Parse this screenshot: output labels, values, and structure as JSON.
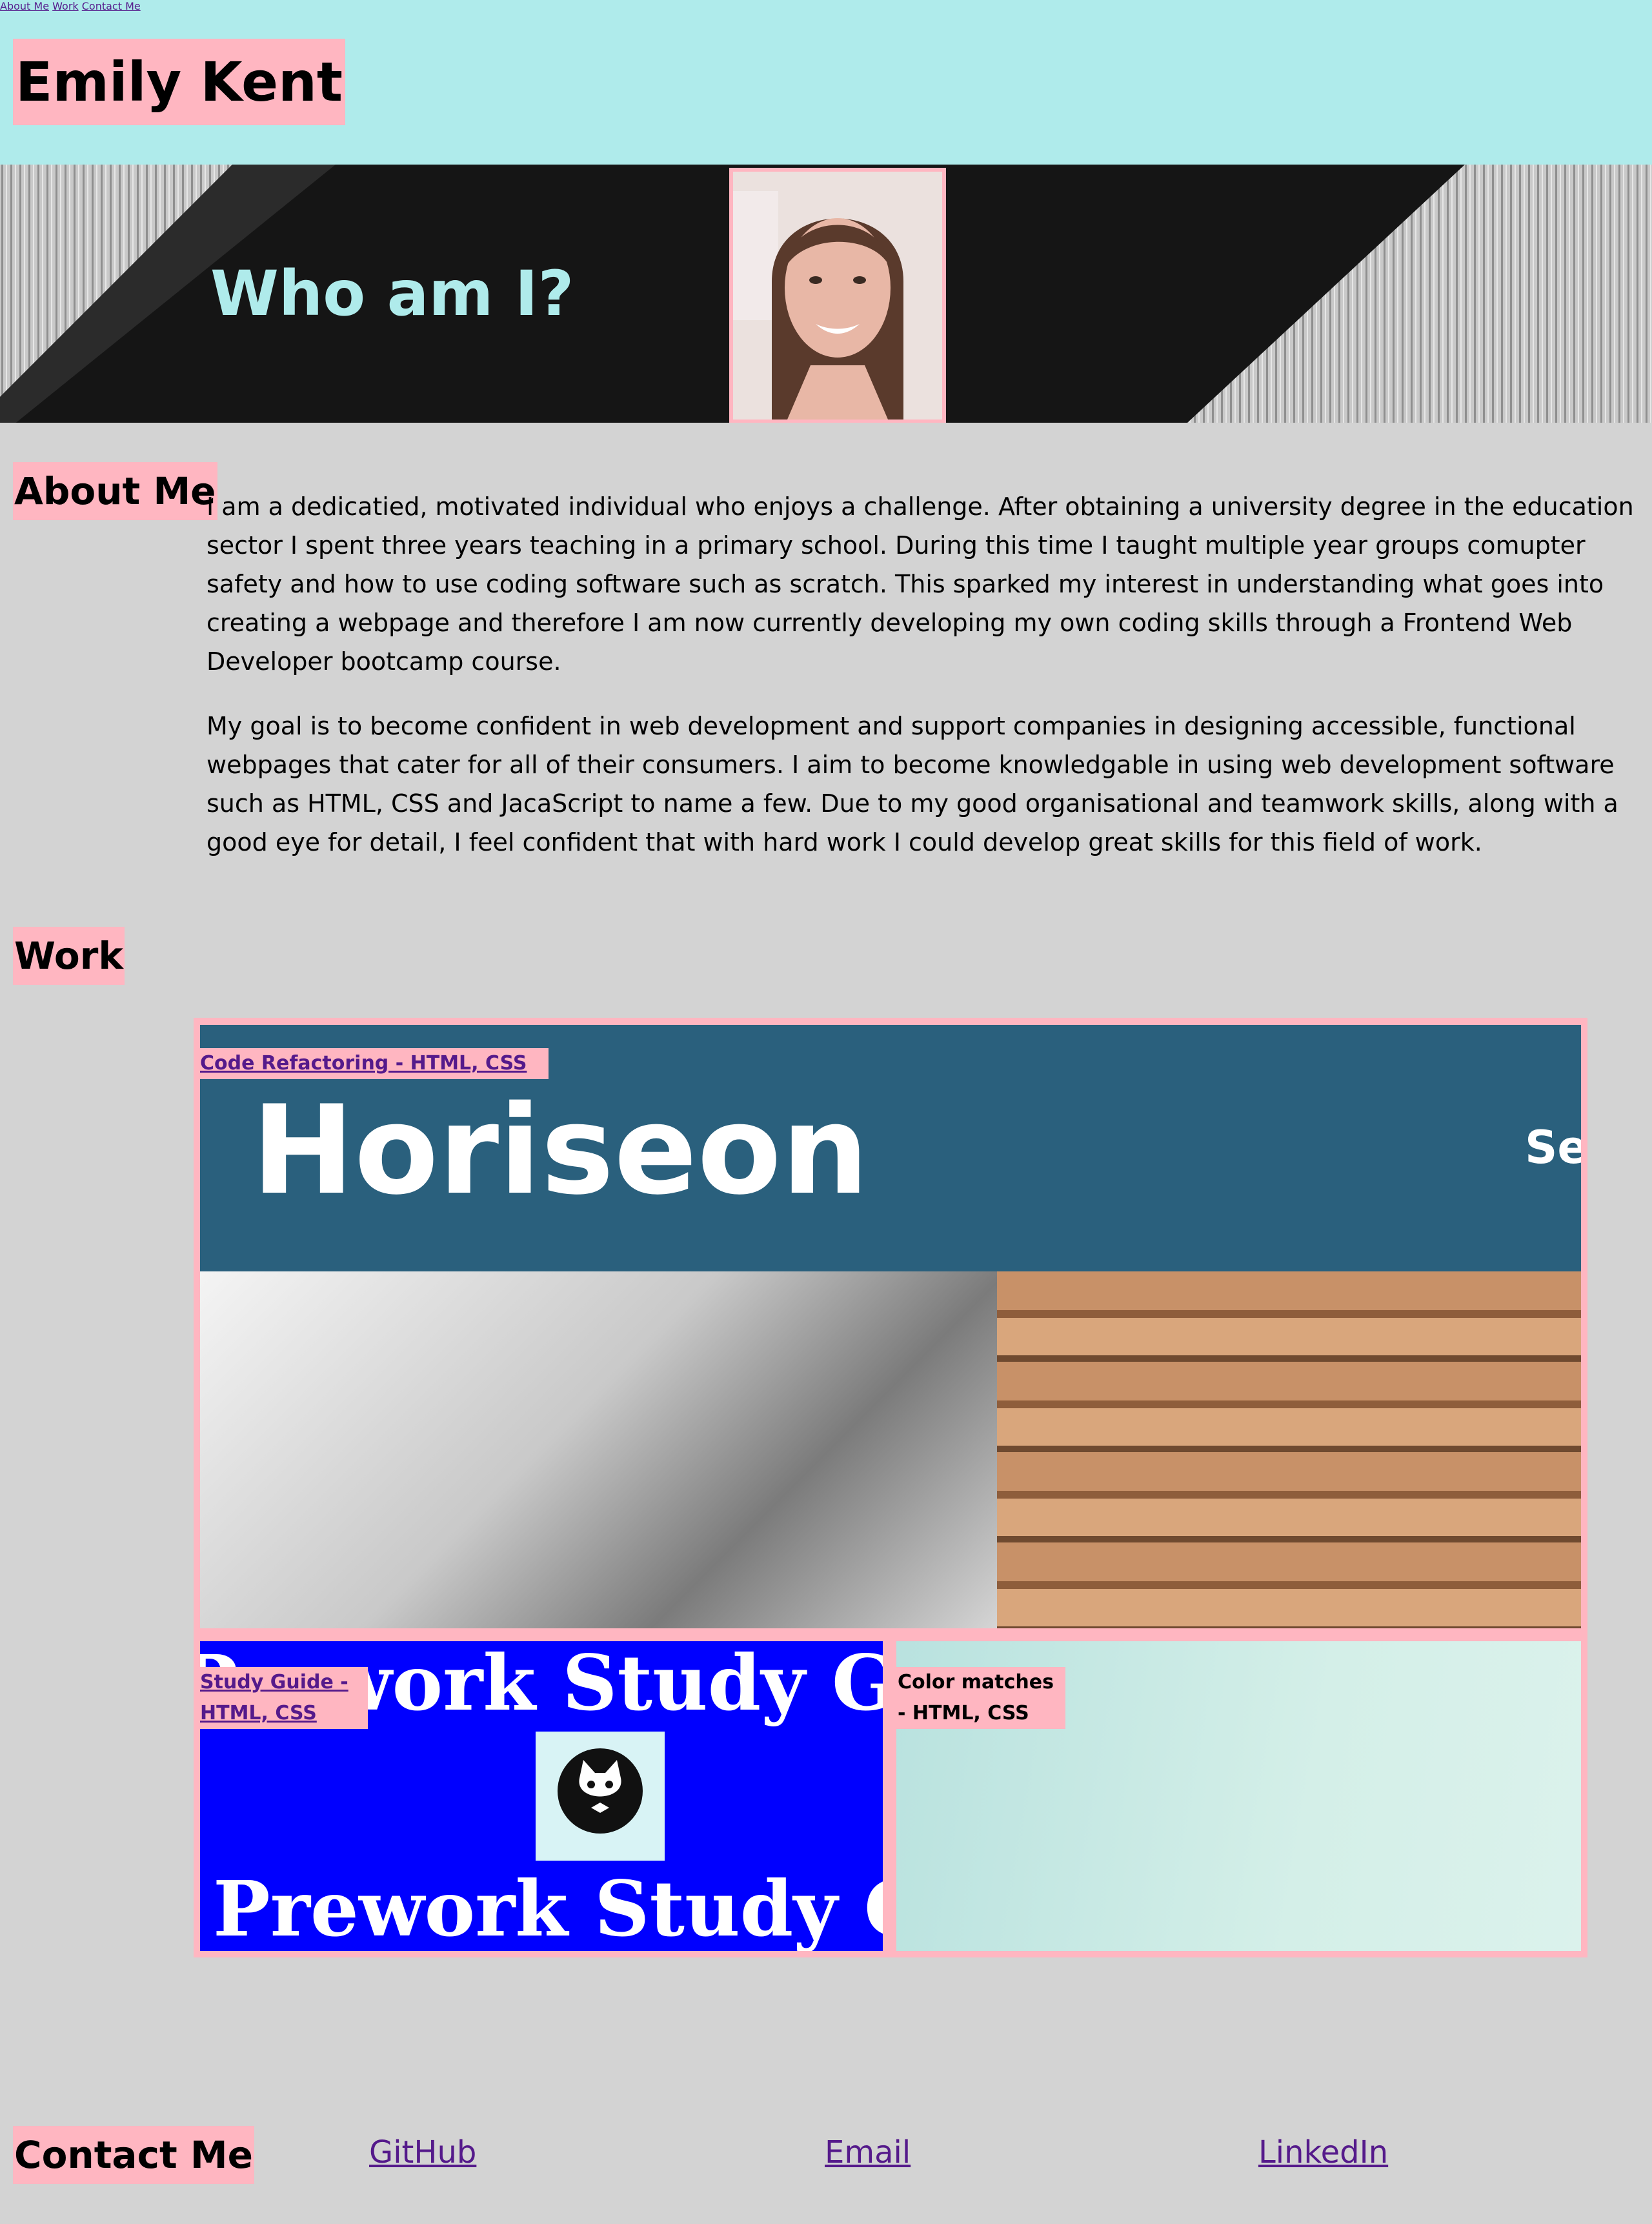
{
  "header": {
    "site_name": "Emily Kent",
    "nav": [
      "About Me",
      "Work",
      "Contact Me"
    ]
  },
  "hero": {
    "title": "Who am I?",
    "portrait_icon": "portrait-photo"
  },
  "about": {
    "heading": "About Me",
    "paragraphs": [
      "I am a dedicatied, motivated individual who enjoys a challenge. After obtaining a university degree in the education sector I spent three years teaching in a primary school. During this time I taught multiple year groups comupter safety and how to use coding software such as scratch. This sparked my interest in understanding what goes into creating a webpage and therefore I am now currently developing my own coding skills through a Frontend Web Developer bootcamp course.",
      "My goal is to become confident in web development and support companies in designing accessible, functional webpages that cater for all of their consumers. I aim to become knowledgable in using web development software such as HTML, CSS and JacaScript to name a few. Due to my good organisational and teamwork skills, along with a good eye for detail, I feel confident that with hard work I could develop great skills for this field of work."
    ]
  },
  "work": {
    "heading": "Work",
    "projects": [
      {
        "label": "Code Refactoring - HTML, CSS",
        "screenshot_title": "Horiseon",
        "screenshot_nav": "Sea"
      },
      {
        "label": "Study Guide - HTML, CSS",
        "screenshot_title": "Prework Study Gui"
      },
      {
        "label": "Color matches - HTML, CSS"
      }
    ]
  },
  "contact": {
    "heading": "Contact Me",
    "links": [
      "GitHub",
      "Email",
      "LinkedIn"
    ]
  },
  "colors": {
    "header_bg": "#afebeb",
    "accent_pink": "#ffb6c1",
    "page_bg": "#d3d3d3",
    "link": "#551a8b"
  }
}
